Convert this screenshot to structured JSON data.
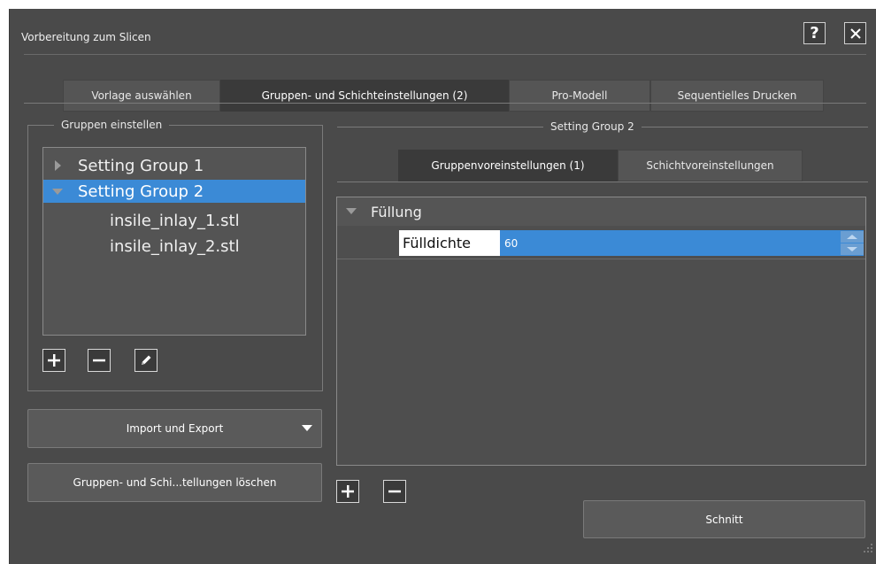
{
  "window": {
    "title": "Vorbereitung zum Slicen"
  },
  "title_buttons": {
    "help": "?",
    "close": "✕"
  },
  "tabs": [
    {
      "label": "Vorlage auswählen",
      "active": false
    },
    {
      "label": "Gruppen- und Schichteinstellungen (2)",
      "active": true
    },
    {
      "label": "Pro-Modell",
      "active": false
    },
    {
      "label": "Sequentielles Drucken",
      "active": false
    }
  ],
  "left_panel": {
    "legend": "Gruppen einstellen",
    "tree": [
      {
        "label": "Setting Group 1",
        "expanded": false,
        "selected": false
      },
      {
        "label": "Setting Group 2",
        "expanded": true,
        "selected": true
      },
      {
        "label": "insile_inlay_1.stl"
      },
      {
        "label": "insile_inlay_2.stl"
      }
    ],
    "icons": [
      "plus-icon",
      "minus-icon",
      "pencil-icon"
    ],
    "import_export_label": "Import und Export",
    "delete_label": "Gruppen- und Schi...tellungen löschen"
  },
  "right_panel": {
    "legend": "Setting Group 2",
    "subtabs": [
      {
        "label": "Gruppenvoreinstellungen (1)",
        "active": true
      },
      {
        "label": "Schichtvoreinstellungen",
        "active": false
      }
    ],
    "section": "Füllung",
    "property": {
      "label": "Fülldichte",
      "value": "60"
    },
    "icons": [
      "plus-icon",
      "minus-icon"
    ]
  },
  "footer": {
    "slice_label": "Schnitt"
  },
  "colors": {
    "window_bg": "#4a4a4a",
    "selection": "#3b8ad6",
    "active_tab": "#3a3a3a"
  }
}
